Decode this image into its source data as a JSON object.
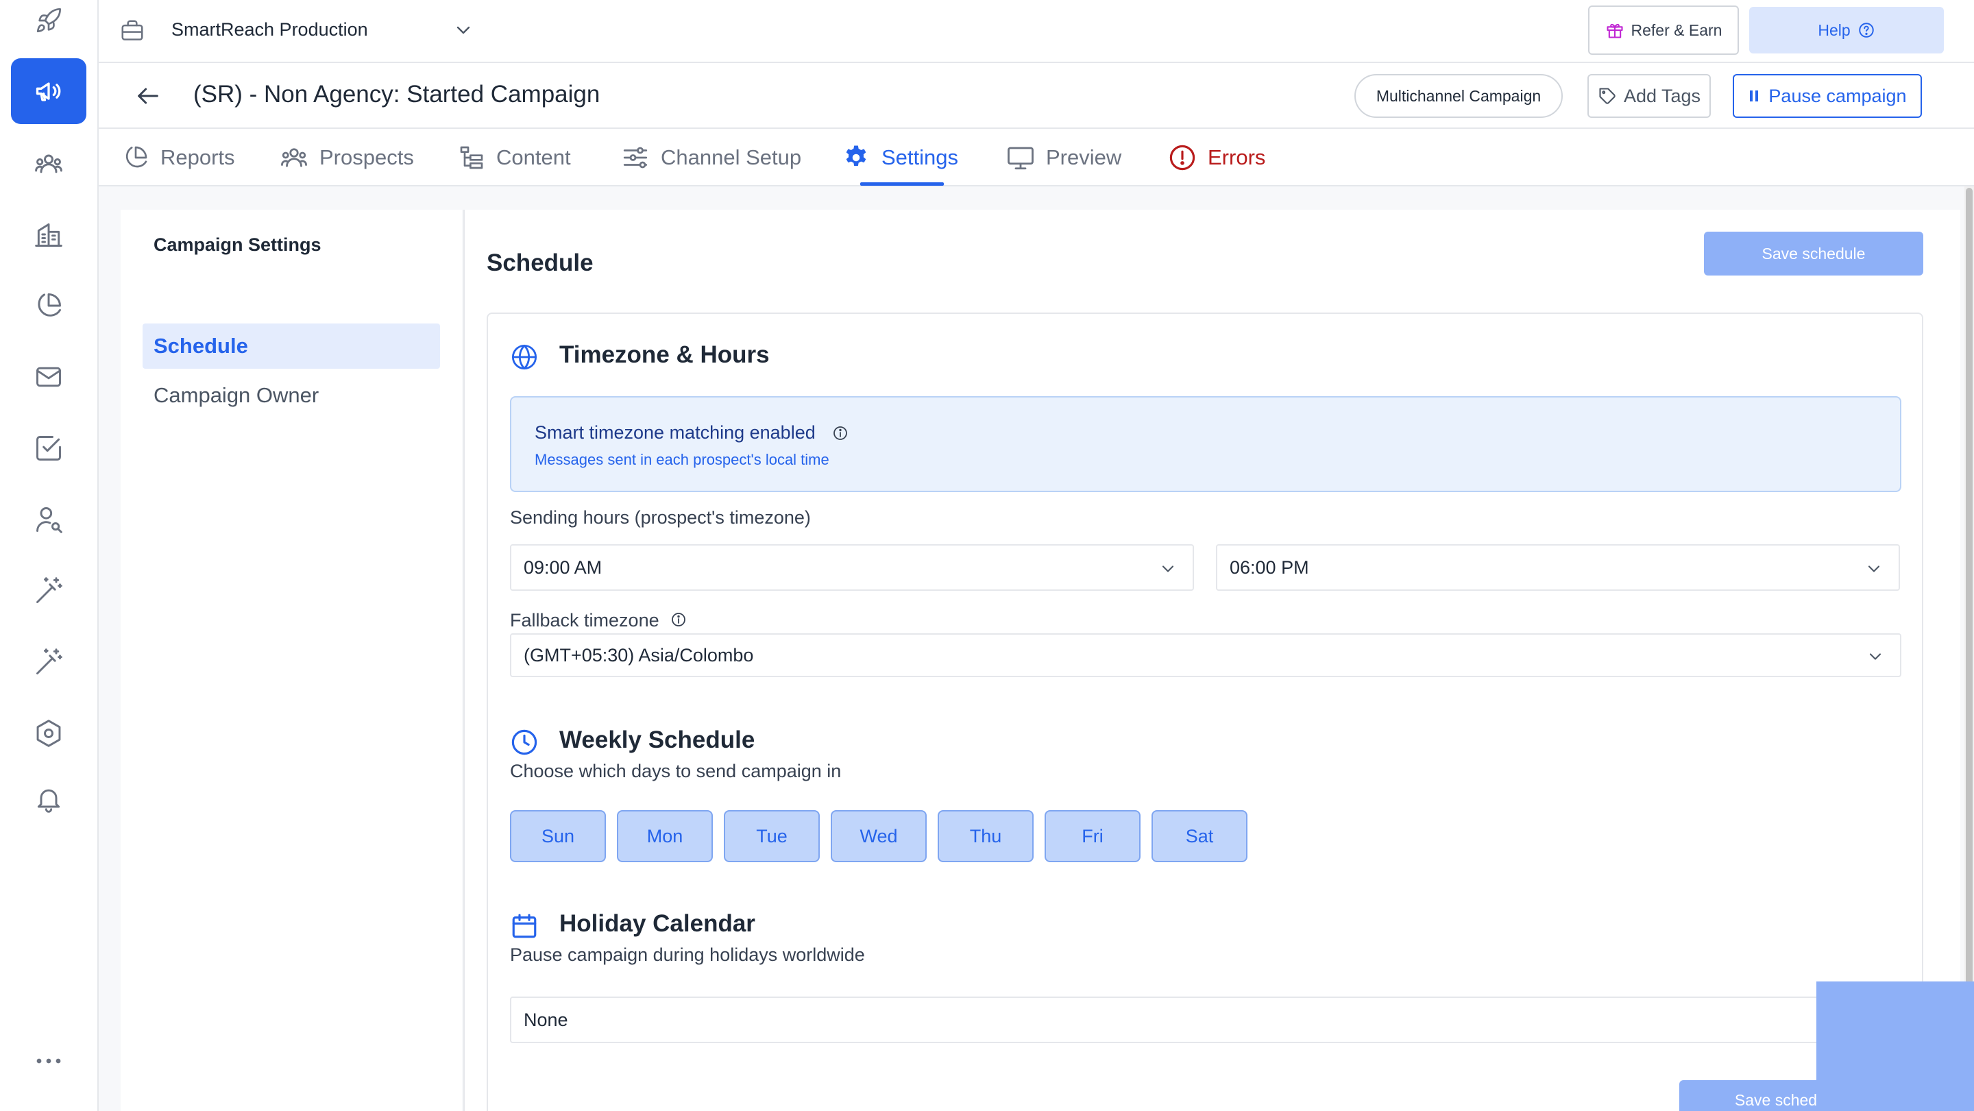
{
  "workspace": {
    "name": "SmartReach Production"
  },
  "topbar": {
    "refer_label": "Refer & Earn",
    "help_label": "Help"
  },
  "campaign": {
    "title": "(SR) - Non Agency: Started Campaign",
    "multichannel_label": "Multichannel Campaign",
    "add_tags_label": "Add Tags",
    "pause_label": "Pause campaign"
  },
  "tabs": [
    {
      "label": "Reports",
      "icon": "pie-chart-icon"
    },
    {
      "label": "Prospects",
      "icon": "users-icon"
    },
    {
      "label": "Content",
      "icon": "content-tree-icon"
    },
    {
      "label": "Channel Setup",
      "icon": "sliders-icon"
    },
    {
      "label": "Settings",
      "icon": "gear-icon",
      "active": true
    },
    {
      "label": "Preview",
      "icon": "monitor-icon"
    },
    {
      "label": "Errors",
      "icon": "alert-circle-icon"
    }
  ],
  "sidebar": {
    "title": "Campaign Settings",
    "items": [
      {
        "label": "Schedule",
        "active": true
      },
      {
        "label": "Campaign Owner"
      }
    ]
  },
  "main": {
    "title": "Schedule",
    "save_label": "Save schedule",
    "save_bottom_label": "Save sched"
  },
  "timezone": {
    "heading": "Timezone & Hours",
    "info_title": "Smart timezone matching enabled",
    "info_sub": "Messages sent in each prospect's local time",
    "sending_hours_label": "Sending hours (prospect's timezone)",
    "start_time": "09:00 AM",
    "end_time": "06:00 PM",
    "fallback_label": "Fallback timezone",
    "fallback_value": "(GMT+05:30) Asia/Colombo"
  },
  "weekly": {
    "heading": "Weekly Schedule",
    "sub": "Choose which days to send campaign in",
    "days": [
      "Sun",
      "Mon",
      "Tue",
      "Wed",
      "Thu",
      "Fri",
      "Sat"
    ]
  },
  "holiday": {
    "heading": "Holiday Calendar",
    "sub": "Pause campaign during holidays worldwide",
    "value": "None"
  },
  "colors": {
    "accent": "#2563eb",
    "error": "#b91c1c",
    "selected_day_bg": "#c0d5fb",
    "disabled_button": "#8eb0f7"
  }
}
